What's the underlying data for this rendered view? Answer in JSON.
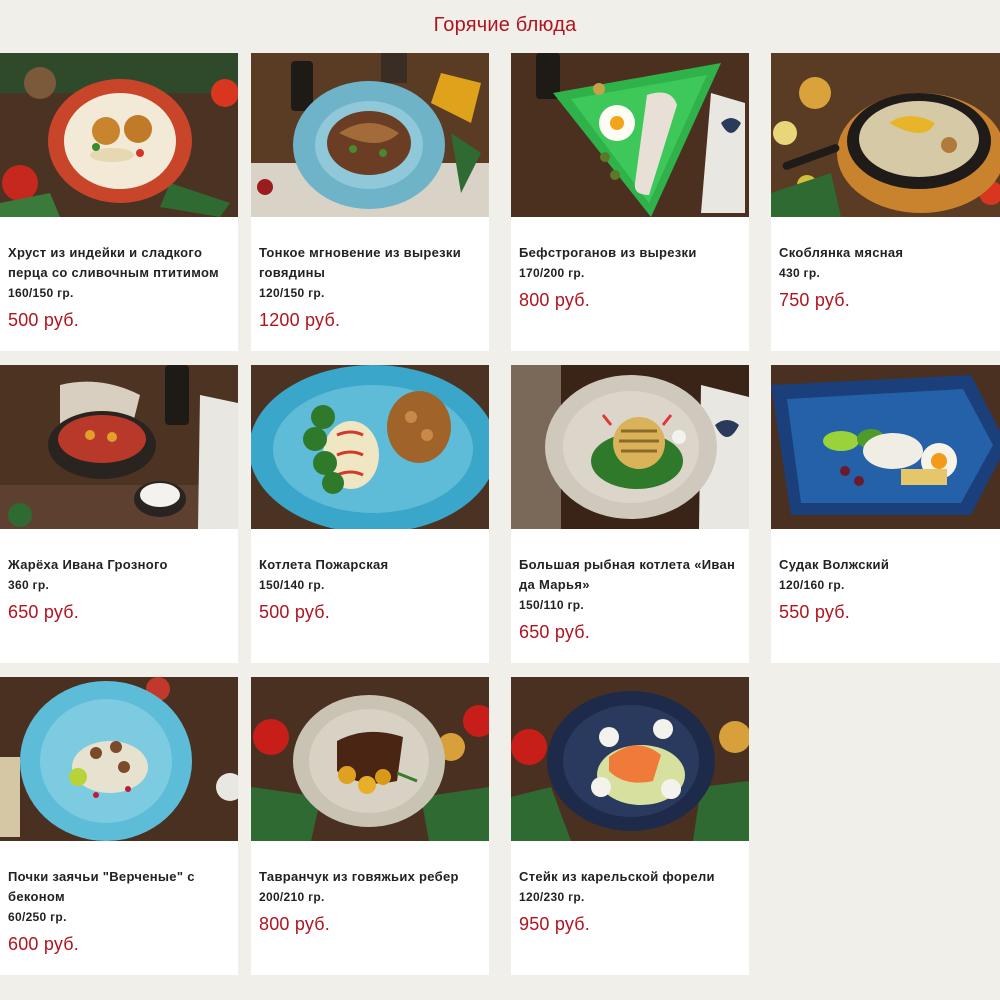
{
  "section": {
    "title": "Горячие блюда"
  },
  "colors": {
    "accent": "#b2141f",
    "text": "#222222",
    "background": "#f1efea",
    "card": "#ffffff"
  },
  "dishes": [
    {
      "name": "Хруст из индейки и сладкого перца со сливочным птитимом",
      "weight": "160/150 гр.",
      "price": "500 руб.",
      "photo": "dish-photo"
    },
    {
      "name": "Тонкое мгновение из вырезки говядины",
      "weight": "120/150 гр.",
      "price": "1200 руб.",
      "photo": "dish-photo"
    },
    {
      "name": "Бефстроганов из вырезки",
      "weight": "170/200 гр.",
      "price": "800 руб.",
      "photo": "dish-photo"
    },
    {
      "name": "Скоблянка мясная",
      "weight": "430 гр.",
      "price": "750 руб.",
      "photo": "dish-photo"
    },
    {
      "name": "Жарёха Ивана Грозного",
      "weight": "360 гр.",
      "price": "650 руб.",
      "photo": "dish-photo"
    },
    {
      "name": "Котлета Пожарская",
      "weight": "150/140 гр.",
      "price": "500 руб.",
      "photo": "dish-photo"
    },
    {
      "name": "Большая рыбная котлета «Иван да Марья»",
      "weight": "150/110 гр.",
      "price": "650 руб.",
      "photo": "dish-photo"
    },
    {
      "name": "Судак Волжский",
      "weight": "120/160 гр.",
      "price": "550 руб.",
      "photo": "dish-photo"
    },
    {
      "name": "Почки заячьи \"Верченые\" с беконом",
      "weight": "60/250 гр.",
      "price": "600 руб.",
      "photo": "dish-photo"
    },
    {
      "name": "Тавранчук из говяжьих ребер",
      "weight": "200/210 гр.",
      "price": "800 руб.",
      "photo": "dish-photo"
    },
    {
      "name": "Стейк из карельской форели",
      "weight": "120/230 гр.",
      "price": "950 руб.",
      "photo": "dish-photo"
    }
  ]
}
